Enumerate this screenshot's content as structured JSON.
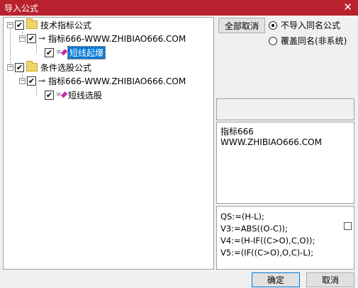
{
  "window": {
    "title": "导入公式",
    "close_glyph": "✕"
  },
  "tree": {
    "groups": [
      {
        "label": "技术指标公式",
        "source": "指标666-WWW.ZHIBIAO666.COM",
        "item": "短线起爆"
      },
      {
        "label": "条件选股公式",
        "source": "指标666-WWW.ZHIBIAO666.COM",
        "item": "短线选股"
      }
    ],
    "expander_glyph": "−",
    "check_glyph": "✔",
    "key_glyph": "⊸"
  },
  "options": {
    "cancel_all": "全部取消",
    "radios": [
      {
        "label": "不导入同名公式",
        "selected": true
      },
      {
        "label": "覆盖同名(非系统)",
        "selected": false
      }
    ]
  },
  "info": {
    "lines": [
      "指标666",
      "WWW.ZHIBIAO666.COM"
    ]
  },
  "code": {
    "lines": [
      "QS:=(H-L);",
      "V3:=ABS((O-C));",
      "V4:=(H-IF((C>O),C,O));",
      "V5:=(IF((C>O),O,C)-L);"
    ]
  },
  "footer": {
    "ok": "确定",
    "cancel": "取消"
  },
  "colors": {
    "titlebar": "#b8222f",
    "selection": "#0078d7"
  }
}
